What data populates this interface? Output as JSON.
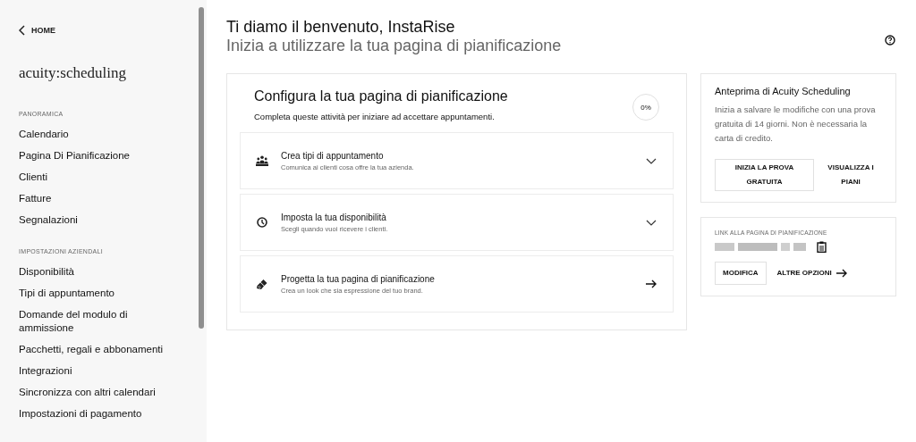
{
  "sidebar": {
    "back_link": "HOME",
    "logo": "acuity:scheduling",
    "sections": [
      {
        "heading": "PANORAMICA",
        "items": [
          "Calendario",
          "Pagina Di Pianificazione",
          "Clienti",
          "Fatture",
          "Segnalazioni"
        ]
      },
      {
        "heading": "IMPOSTAZIONI AZIENDALI",
        "items": [
          "Disponibilità",
          "Tipi di appuntamento",
          "Domande del modulo di ammissione",
          "Pacchetti, regali e abbonamenti",
          "Integrazioni",
          "Sincronizza con altri calendari",
          "Impostazioni di pagamento"
        ]
      }
    ]
  },
  "header": {
    "title": "Ti diamo il benvenuto, InstaRise",
    "subtitle": "Inizia a utilizzare la tua pagina di pianificazione"
  },
  "setup": {
    "title": "Configura la tua pagina di pianificazione",
    "description": "Completa queste attività per iniziare ad accettare appuntamenti.",
    "progress": "0%",
    "tasks": [
      {
        "title": "Crea tipi di appuntamento",
        "description": "Comunica ai clienti cosa offre la tua azienda.",
        "kind": "expand"
      },
      {
        "title": "Imposta la tua disponibilità",
        "description": "Scegli quando vuoi ricevere i clienti.",
        "kind": "expand"
      },
      {
        "title": "Progetta la tua pagina di pianificazione",
        "description": "Crea un look che sia espressione del tuo brand.",
        "kind": "link"
      }
    ]
  },
  "preview": {
    "title": "Anteprima di Acuity Scheduling",
    "text": "Inizia a salvare le modifiche con una prova gratuita di 14 giorni. Non è necessaria la carta di credito.",
    "primary_button": "INIZIA LA PROVA GRATUITA",
    "secondary_button": "VISUALIZZA I PIANI"
  },
  "link_card": {
    "label": "LINK ALLA PAGINA DI PIANIFICAZIONE",
    "edit_button": "MODIFICA",
    "more_button": "ALTRE OPZIONI"
  }
}
